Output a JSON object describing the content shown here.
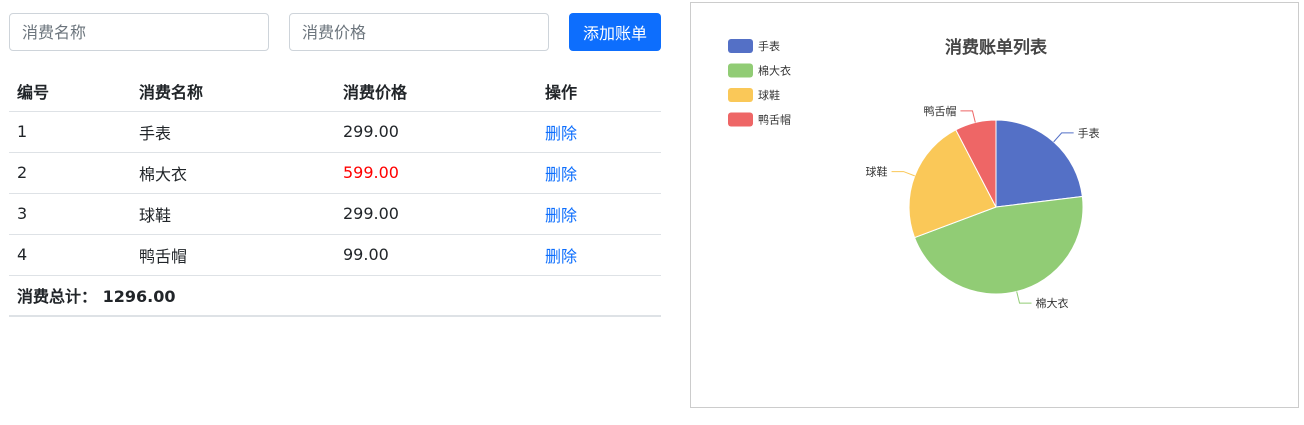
{
  "form": {
    "name_placeholder": "消费名称",
    "price_placeholder": "消费价格",
    "add_button_label": "添加账单"
  },
  "table": {
    "headers": [
      "编号",
      "消费名称",
      "消费价格",
      "操作"
    ],
    "rows": [
      {
        "id": "1",
        "name": "手表",
        "price": "299.00",
        "action": "删除"
      },
      {
        "id": "2",
        "name": "棉大衣",
        "price": "599.00",
        "action": "删除"
      },
      {
        "id": "3",
        "name": "球鞋",
        "price": "299.00",
        "action": "删除"
      },
      {
        "id": "4",
        "name": "鸭舌帽",
        "price": "99.00",
        "action": "删除"
      }
    ],
    "total_label": "消费总计：",
    "total_value": "1296.00"
  },
  "chart_data": {
    "type": "pie",
    "title": "消费账单列表",
    "legend_position": "top-left",
    "categories": [
      "手表",
      "棉大衣",
      "球鞋",
      "鸭舌帽"
    ],
    "values": [
      299,
      599,
      299,
      99
    ],
    "colors": [
      "#5470c6",
      "#91cc75",
      "#fac858",
      "#ee6666"
    ]
  }
}
